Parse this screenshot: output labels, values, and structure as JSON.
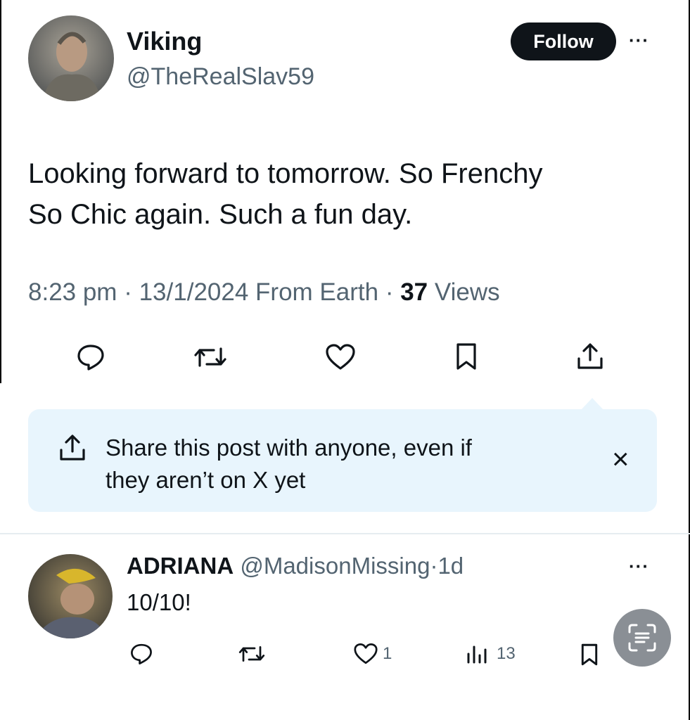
{
  "post": {
    "author_name": "Viking",
    "author_handle": "@TheRealSlav59",
    "follow_label": "Follow",
    "more_label": "···",
    "text_line1": "Looking forward to tomorrow.  So Frenchy",
    "text_line2": "So Chic again. Such a fun day.",
    "time": "8:23 pm",
    "date": "13/1/2024",
    "source": "From Earth",
    "separator": "·",
    "views_count": "37",
    "views_label": "Views"
  },
  "actions": {
    "icons": [
      "reply-icon",
      "repost-icon",
      "like-icon",
      "bookmark-icon",
      "share-icon"
    ]
  },
  "share_banner": {
    "line1": "Share this post with anyone, even if",
    "line2": "they aren’t on X yet",
    "close_label": "×"
  },
  "reply": {
    "author_name": "ADRIANA",
    "author_handle": "@MadisonMissing",
    "separator": "·",
    "age": "1d",
    "more_label": "···",
    "text": "10/10!",
    "like_count": "1",
    "views_count": "13"
  },
  "colors": {
    "text": "#0f1419",
    "muted": "#536471",
    "banner_bg": "#e8f5fd",
    "follow_bg": "#0f1419"
  }
}
